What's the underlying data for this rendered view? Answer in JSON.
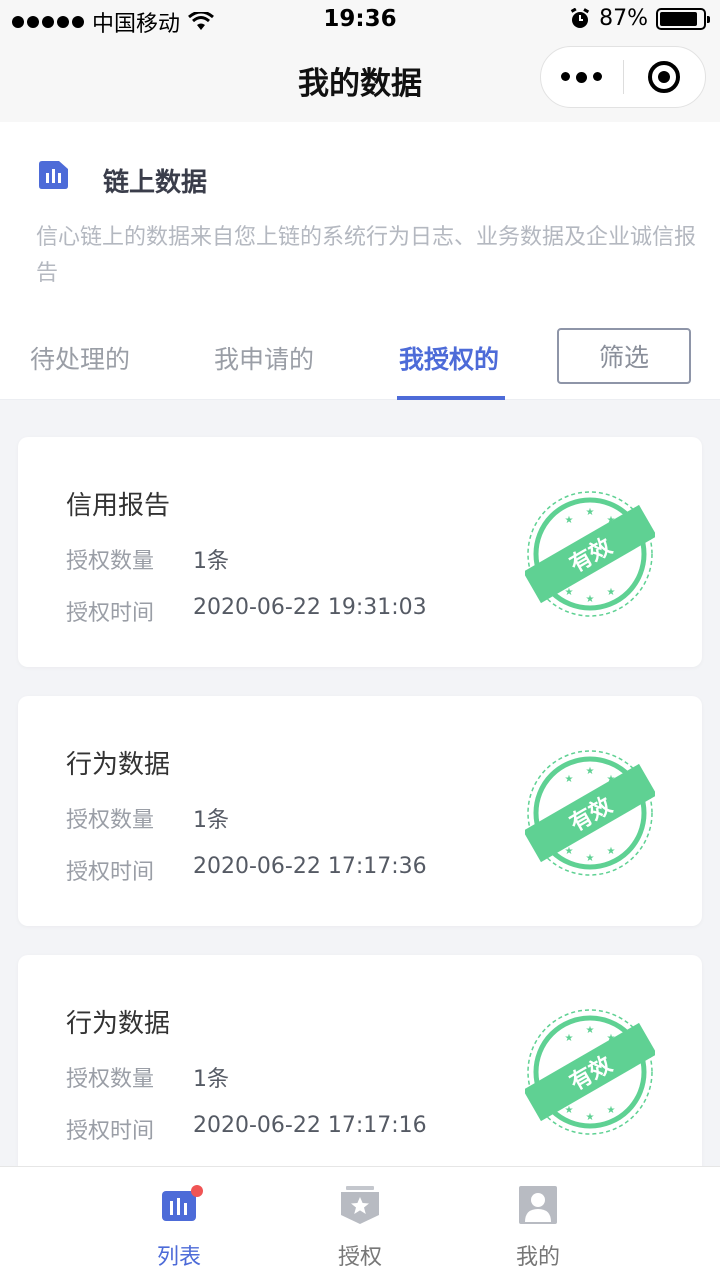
{
  "status_bar": {
    "carrier": "中国移动",
    "time": "19:36",
    "battery": "87%",
    "battery_level": 0.87
  },
  "nav": {
    "title": "我的数据"
  },
  "info": {
    "title": "链上数据",
    "description": "信心链上的数据来自您上链的系统行为日志、业务数据及企业诚信报告",
    "icon": "bar-chart-icon"
  },
  "tabs": [
    {
      "label": "待处理的",
      "active": false
    },
    {
      "label": "我申请的",
      "active": false
    },
    {
      "label": "我授权的",
      "active": true
    }
  ],
  "filter_label": "筛选",
  "cards": [
    {
      "title": "信用报告",
      "count_label": "授权数量",
      "count": "1条",
      "time_label": "授权时间",
      "time": "2020-06-22 19:31:03",
      "stamp": "有效"
    },
    {
      "title": "行为数据",
      "count_label": "授权数量",
      "count": "1条",
      "time_label": "授权时间",
      "time": "2020-06-22 17:17:36",
      "stamp": "有效"
    },
    {
      "title": "行为数据",
      "count_label": "授权数量",
      "count": "1条",
      "time_label": "授权时间",
      "time": "2020-06-22 17:17:16",
      "stamp": "有效"
    }
  ],
  "tabbar": [
    {
      "label": "列表",
      "icon": "list-chart-icon",
      "active": true,
      "badge": true
    },
    {
      "label": "授权",
      "icon": "star-shield-icon",
      "active": false,
      "badge": false
    },
    {
      "label": "我的",
      "icon": "user-icon",
      "active": false,
      "badge": false
    }
  ],
  "colors": {
    "accent": "#4d6bd8",
    "stamp_green": "#5fd193",
    "badge_red": "#f05454"
  }
}
